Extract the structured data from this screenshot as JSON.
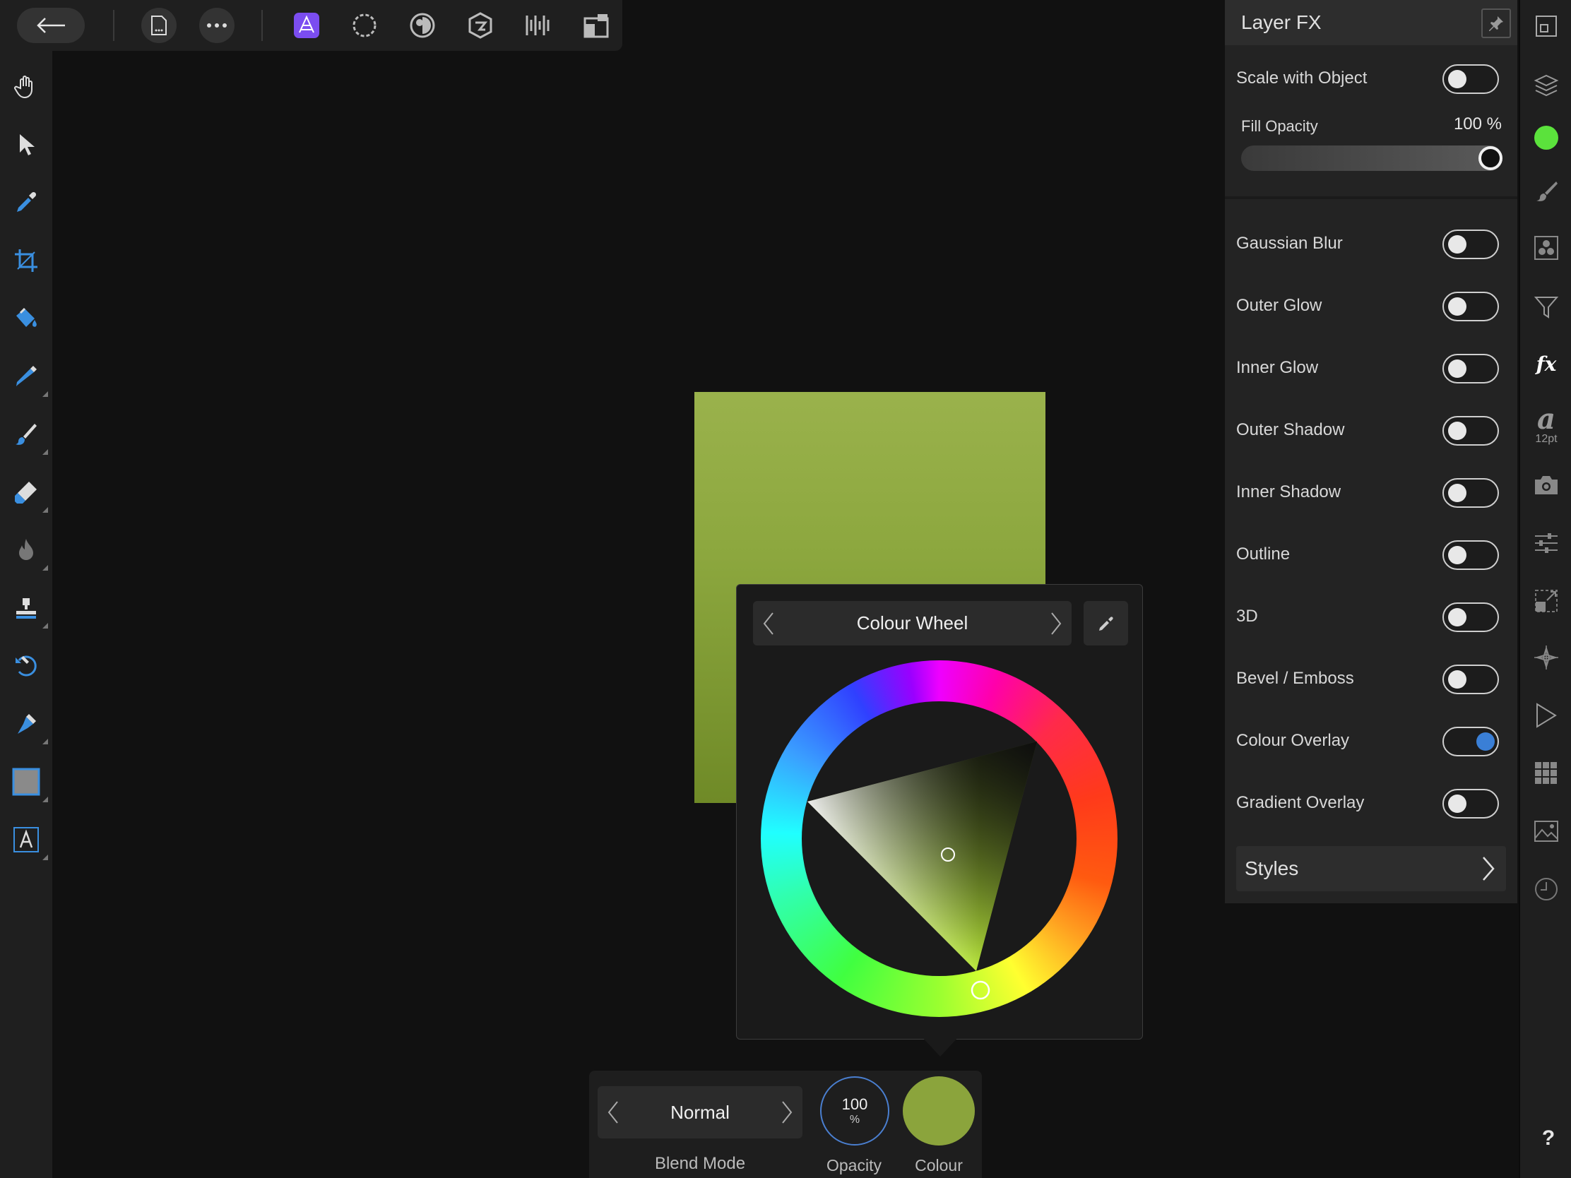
{
  "top_toolbar": {
    "back_icon": "arrow-left-icon",
    "document_icon": "document-icon",
    "more_icon": "more-icon",
    "personas": [
      "photo-persona-icon",
      "liquify-persona-icon",
      "develop-persona-icon",
      "tone-mapping-persona-icon",
      "export-persona-icon",
      "view-mode-icon"
    ]
  },
  "left_tools": [
    "hand-tool-icon",
    "move-tool-icon",
    "color-picker-tool-icon",
    "crop-tool-icon",
    "flood-fill-tool-icon",
    "selection-brush-tool-icon",
    "paint-brush-tool-icon",
    "erase-brush-tool-icon",
    "burn-brush-tool-icon",
    "clone-brush-tool-icon",
    "undo-brush-tool-icon",
    "pen-tool-icon",
    "rectangle-tool-icon",
    "text-tool-icon"
  ],
  "artboard_color": "#8ca73e",
  "colour_popup": {
    "mode_label": "Colour Wheel",
    "picker_icon": "eyedropper-icon"
  },
  "context_bar": {
    "blend_mode_value": "Normal",
    "blend_mode_caption": "Blend Mode",
    "opacity_value": "100",
    "opacity_unit": "%",
    "opacity_caption": "Opacity",
    "colour_caption": "Colour",
    "colour_value": "#8ba43c"
  },
  "layer_fx": {
    "title": "Layer FX",
    "scale_with_object": {
      "label": "Scale with Object",
      "on": false
    },
    "fill_opacity": {
      "label": "Fill Opacity",
      "value": "100 %",
      "level": 1.0
    },
    "effects": [
      {
        "label": "Gaussian Blur",
        "on": false
      },
      {
        "label": "Outer Glow",
        "on": false
      },
      {
        "label": "Inner Glow",
        "on": false
      },
      {
        "label": "Outer Shadow",
        "on": false
      },
      {
        "label": "Inner Shadow",
        "on": false
      },
      {
        "label": "Outline",
        "on": false
      },
      {
        "label": "3D",
        "on": false
      },
      {
        "label": "Bevel / Emboss",
        "on": false
      },
      {
        "label": "Colour Overlay",
        "on": true
      },
      {
        "label": "Gradient Overlay",
        "on": false
      }
    ],
    "styles_label": "Styles"
  },
  "right_studio": {
    "icons": [
      "navigator-icon",
      "layers-icon",
      "colour-icon",
      "brushes-icon",
      "channels-icon",
      "filter-icon",
      "fx-icon",
      "text-style-icon",
      "camera-icon",
      "adjustments-icon",
      "transform-icon",
      "snapping-icon",
      "play-icon",
      "grid-icon",
      "image-icon",
      "history-icon"
    ],
    "fx_glyph": "fx",
    "text_style_glyph": "a",
    "text_style_size": "12pt",
    "colour_dot": "#5be23c",
    "help": "?"
  },
  "colors": {
    "accent": "#3a7fd6",
    "persona_active": "#7b4df0"
  }
}
